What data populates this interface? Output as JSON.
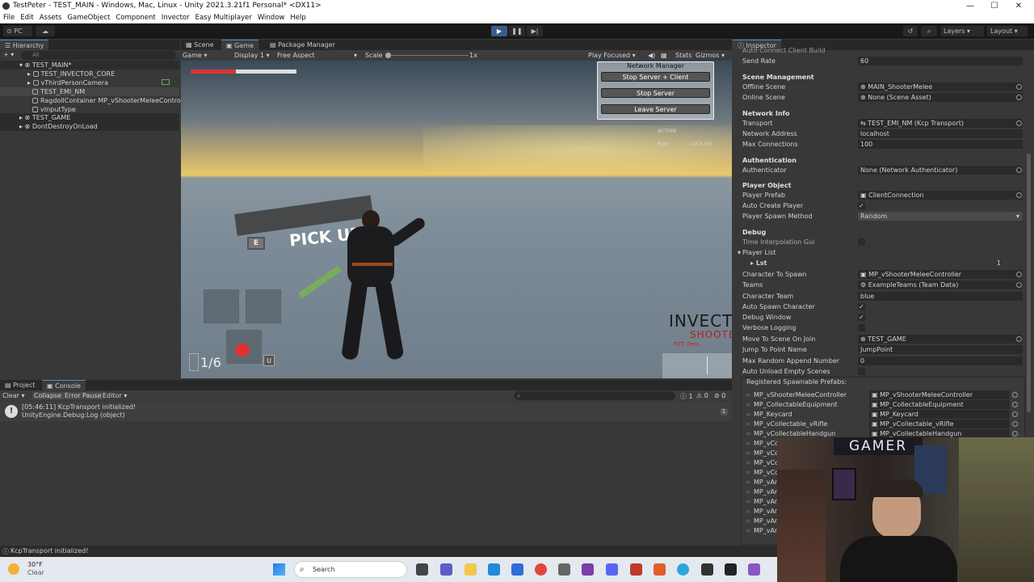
{
  "window": {
    "title": "TestPeter - TEST_MAIN - Windows, Mac, Linux - Unity 2021.3.21f1 Personal* <DX11>",
    "minimize": "—",
    "maximize": "☐",
    "close": "✕"
  },
  "menu": [
    "File",
    "Edit",
    "Assets",
    "GameObject",
    "Component",
    "Invector",
    "Easy Multiplayer",
    "Window",
    "Help"
  ],
  "toolbar": {
    "platform": "PC",
    "layers": "Layers",
    "layout": "Layout"
  },
  "hierarchy": {
    "tab": "Hierarchy",
    "search_placeholder": "All",
    "items": [
      {
        "label": "TEST_MAIN*"
      },
      {
        "label": "TEST_INVECTOR_CORE"
      },
      {
        "label": "vThirdPersonCamera"
      },
      {
        "label": "TEST_EMI_NM"
      },
      {
        "label": "RagdollContainer MP_vShooterMeleeControll"
      },
      {
        "label": "vInputType"
      },
      {
        "label": "TEST_GAME"
      },
      {
        "label": "DontDestroyOnLoad"
      }
    ]
  },
  "scene_tabs": {
    "scene": "Scene",
    "game": "Game",
    "package_manager": "Package Manager"
  },
  "game_toolbar": {
    "mode": "Game",
    "display": "Display 1",
    "aspect": "Free Aspect",
    "scale_label": "Scale",
    "scale_value": "1x",
    "play_focused": "Play Focused",
    "stats": "Stats",
    "gizmos": "Gizmos"
  },
  "network_manager": {
    "title": "Network Manager",
    "buttons": [
      "Stop Server + Client",
      "Stop Server",
      "Leave Server"
    ]
  },
  "game_hud": {
    "pickup_key": "E",
    "pickup_text": "PICK UP",
    "ammo": "1/6",
    "slot_key": "U",
    "action_label": "ACTION",
    "run_label": "RUN",
    "lockon_label": "LOCK-ON",
    "invector_logo": "INVECTOR",
    "shooter_logo": "SHOOTER",
    "rtt": "RTT: 0ms",
    "health_fraction": 0.43
  },
  "inspector": {
    "tab": "Inspector",
    "rows": [
      {
        "kind": "label",
        "label": "Auto Connect Client Build"
      },
      {
        "kind": "field",
        "label": "Send Rate",
        "value": "60"
      },
      {
        "kind": "header",
        "label": "Scene Management"
      },
      {
        "kind": "field",
        "label": "Offline Scene",
        "value": "MAIN_ShooterMelee",
        "icon": true
      },
      {
        "kind": "field",
        "label": "Online Scene",
        "value": "None (Scene Asset)",
        "icon": true
      },
      {
        "kind": "header",
        "label": "Network Info"
      },
      {
        "kind": "field",
        "label": "Transport",
        "value": "TEST_EMI_NM (Kcp Transport)",
        "icon": true
      },
      {
        "kind": "field",
        "label": "Network Address",
        "value": "localhost"
      },
      {
        "kind": "field",
        "label": "Max Connections",
        "value": "100"
      },
      {
        "kind": "header",
        "label": "Authentication"
      },
      {
        "kind": "field",
        "label": "Authenticator",
        "value": "None (Network Authenticator)",
        "icon": true
      },
      {
        "kind": "header",
        "label": "Player Object"
      },
      {
        "kind": "field",
        "label": "Player Prefab",
        "value": "ClientConnection",
        "icon": true
      },
      {
        "kind": "check",
        "label": "Auto Create Player",
        "checked": true
      },
      {
        "kind": "field",
        "label": "Player Spawn Method",
        "value": "Random"
      },
      {
        "kind": "header",
        "label": "Debug"
      },
      {
        "kind": "check",
        "label": "Time Interpolation Gui",
        "checked": false
      },
      {
        "kind": "label",
        "label": "Player List"
      },
      {
        "kind": "field",
        "label": "Lst",
        "value": "1"
      },
      {
        "kind": "field",
        "label": "Character To Spawn",
        "value": "MP_vShooterMeleeController",
        "icon": true
      },
      {
        "kind": "field",
        "label": "Teams",
        "value": "ExampleTeams (Team Data)",
        "icon": true
      },
      {
        "kind": "field",
        "label": "Character Team",
        "value": "blue"
      },
      {
        "kind": "check",
        "label": "Auto Spawn Character",
        "checked": true
      },
      {
        "kind": "check",
        "label": "Debug Window",
        "checked": true
      },
      {
        "kind": "check",
        "label": "Verbose Logging",
        "checked": false
      },
      {
        "kind": "field",
        "label": "Move To Scene On Join",
        "value": "TEST_GAME",
        "icon": true
      },
      {
        "kind": "field",
        "label": "Jump To Point Name",
        "value": "JumpPoint"
      },
      {
        "kind": "field",
        "label": "Max Random Append Number",
        "value": "0"
      },
      {
        "kind": "check",
        "label": "Auto Unload Empty Scenes",
        "checked": false
      }
    ],
    "prefabs_header": "Registered Spawnable Prefabs:",
    "prefabs": [
      {
        "name": "MP_vShooterMeleeController",
        "value": "MP_vShooterMeleeController"
      },
      {
        "name": "MP_CollectableEquipment",
        "value": "MP_CollectableEquipment"
      },
      {
        "name": "MP_Keycard",
        "value": "MP_Keycard"
      },
      {
        "name": "MP_vCollectable_vRifle",
        "value": "MP_vCollectable_vRifle"
      },
      {
        "name": "MP_vCollectableHandgun",
        "value": "MP_vCollectableHandgun"
      },
      {
        "name": "MP_vCo",
        "value": ""
      },
      {
        "name": "MP_vCo",
        "value": ""
      },
      {
        "name": "MP_vCo",
        "value": ""
      },
      {
        "name": "MP_vCo",
        "value": ""
      },
      {
        "name": "MP_vAm",
        "value": ""
      },
      {
        "name": "MP_vAr",
        "value": ""
      },
      {
        "name": "MP_vAr",
        "value": ""
      },
      {
        "name": "MP_vAr",
        "value": ""
      },
      {
        "name": "MP_vAr",
        "value": ""
      },
      {
        "name": "MP_vAr",
        "value": ""
      }
    ]
  },
  "bottom": {
    "project_tab": "Project",
    "console_tab": "Console",
    "clear": "Clear",
    "collapse": "Collapse",
    "error_pause": "Error Pause",
    "editor": "Editor",
    "count_info": "1",
    "count_warn": "0",
    "count_error": "0",
    "log_line1": "[05:46:11] KcpTransport initialized!",
    "log_line2": "UnityEngine.Debug:Log (object)",
    "log_count": "1",
    "status": "KcpTransport initialized!"
  },
  "taskbar": {
    "temp": "30°F",
    "weather": "Clear",
    "search": "Search"
  },
  "webcam": {
    "sign": "GAMER"
  }
}
